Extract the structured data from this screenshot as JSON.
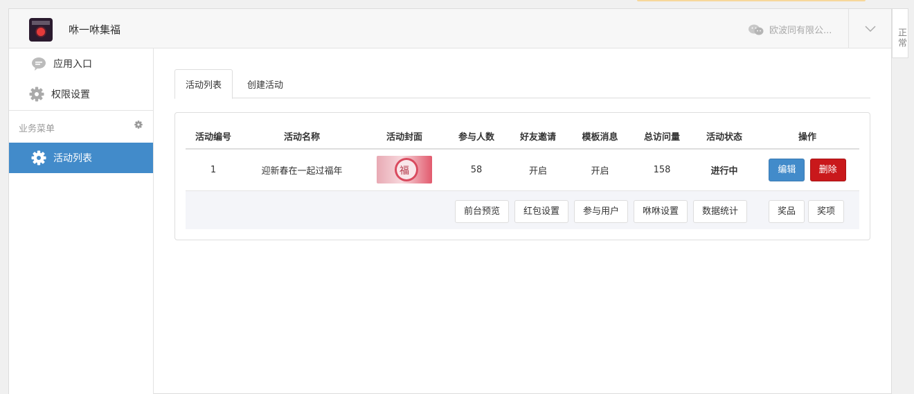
{
  "app": {
    "title": "咻一咻集福",
    "company": "欧波同有限公..."
  },
  "side_tab": {
    "label": "正常"
  },
  "sidebar": {
    "items": [
      {
        "label": "应用入口",
        "icon": "chat-bubble-icon"
      },
      {
        "label": "权限设置",
        "icon": "gear-icon"
      }
    ],
    "section_title": "业务菜单",
    "section_items": [
      {
        "label": "活动列表",
        "icon": "gear-icon",
        "active": true
      }
    ]
  },
  "tabs": [
    {
      "label": "活动列表",
      "active": true
    },
    {
      "label": "创建活动",
      "active": false
    }
  ],
  "table": {
    "headers": [
      "活动编号",
      "活动名称",
      "活动封面",
      "参与人数",
      "好友邀请",
      "模板消息",
      "总访问量",
      "活动状态",
      "操作"
    ],
    "rows": [
      {
        "id": "1",
        "name": "迎新春在一起过福年",
        "cover_char": "福",
        "participants": "58",
        "friend_invite": "开启",
        "template_msg": "开启",
        "total_visits": "158",
        "status": "进行中",
        "actions": {
          "edit": "编辑",
          "delete": "删除"
        }
      }
    ],
    "sub_actions": [
      "前台预览",
      "红包设置",
      "参与用户",
      "咻咻设置",
      "数据统计",
      "奖品",
      "奖项"
    ]
  },
  "colors": {
    "primary": "#428bca",
    "danger": "#c9181b",
    "success": "#2a9a2a"
  }
}
